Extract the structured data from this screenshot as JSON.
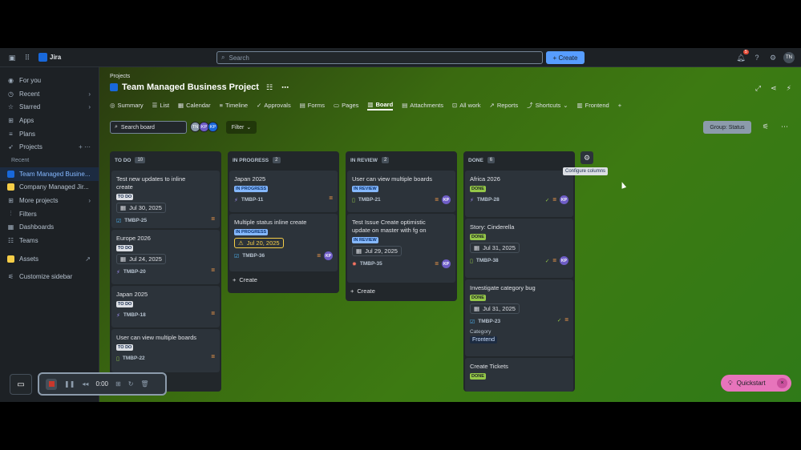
{
  "topnav": {
    "app_name": "Jira",
    "search_placeholder": "Search",
    "create_label": "+ Create",
    "notification_count": "5",
    "user_initials": "TN"
  },
  "sidebar": {
    "items": [
      {
        "label": "For you",
        "icon": "user-circle-icon"
      },
      {
        "label": "Recent",
        "icon": "clock-icon",
        "chevron": "›"
      },
      {
        "label": "Starred",
        "icon": "star-icon",
        "chevron": "›"
      },
      {
        "label": "Apps",
        "icon": "apps-icon"
      },
      {
        "label": "Plans",
        "icon": "plans-icon"
      },
      {
        "label": "Projects",
        "icon": "rocket-icon"
      }
    ],
    "recent_header": "Recent",
    "projects": [
      {
        "label": "Team Managed Busine...",
        "color": "#1868db"
      },
      {
        "label": "Company Managed Jir...",
        "color": "#f5cd47"
      }
    ],
    "more_projects": "More projects",
    "bottom_items": [
      {
        "label": "Filters",
        "icon": "filter-icon"
      },
      {
        "label": "Dashboards",
        "icon": "dashboard-icon"
      },
      {
        "label": "Teams",
        "icon": "people-icon"
      }
    ],
    "assets": "Assets",
    "customize": "Customize sidebar"
  },
  "main": {
    "breadcrumb": "Projects",
    "title": "Team Managed Business Project",
    "tabs": [
      "Summary",
      "List",
      "Calendar",
      "Timeline",
      "Approvals",
      "Forms",
      "Pages",
      "Board",
      "Attachments",
      "All work",
      "Reports",
      "Shortcuts",
      "Frontend"
    ],
    "tab_icons": [
      "◎",
      "☰",
      "▦",
      "≡",
      "✓",
      "▤",
      "▭",
      "▥",
      "▤",
      "⊡",
      "↗",
      "⤴",
      "▥"
    ],
    "active_tab": "Board",
    "add_tab": "+",
    "search_board": "Search board",
    "avatars": [
      {
        "initials": "TN",
        "color": "#8c9bab"
      },
      {
        "initials": "KP",
        "color": "#6e5dc6"
      },
      {
        "initials": "KP",
        "color": "#1868db"
      }
    ],
    "filter_label": "Filter",
    "group_label": "Group: Status"
  },
  "columns": [
    {
      "name": "TO DO",
      "count": "10",
      "cards": [
        {
          "title_lines": [
            "Test new updates to inline",
            "create"
          ],
          "status": "TO DO",
          "date": "Jul 30, 2025",
          "key": "TMBP-25",
          "type": "task"
        },
        {
          "title_lines": [
            "Europe 2026"
          ],
          "status": "TO DO",
          "date": "Jul 24, 2025",
          "key": "TMBP-20",
          "type": "epic"
        },
        {
          "title_lines": [
            "Japan 2025"
          ],
          "status": "TO DO",
          "key": "TMBP-18",
          "type": "epic"
        },
        {
          "title_lines": [
            "User can view multiple boards"
          ],
          "status": "TO DO",
          "key": "TMBP-22",
          "type": "story"
        }
      ]
    },
    {
      "name": "IN PROGRESS",
      "count": "2",
      "cards": [
        {
          "title_lines": [
            "Japan 2025"
          ],
          "status": "IN PROGRESS",
          "key": "TMBP-11",
          "type": "epic"
        },
        {
          "title_lines": [
            "Multiple status inline create"
          ],
          "status": "IN PROGRESS",
          "date": "Jul 20, 2025",
          "key": "TMBP-36",
          "type": "task",
          "assignee": "KP"
        }
      ],
      "create": "Create"
    },
    {
      "name": "IN REVIEW",
      "count": "2",
      "cards": [
        {
          "title_lines": [
            "User can view multiple boards"
          ],
          "status": "IN REVIEW",
          "key": "TMBP-21",
          "type": "story",
          "assignee": "KP"
        },
        {
          "title_lines": [
            "Test Issue Create optimistic",
            "update on master with fg on"
          ],
          "status": "IN REVIEW",
          "date": "Jul 29, 2025",
          "key": "TMBP-35",
          "type": "bug",
          "assignee": "KP"
        }
      ],
      "create": "Create"
    },
    {
      "name": "DONE",
      "count": "6",
      "cards": [
        {
          "title_lines": [
            "Africa 2026"
          ],
          "status": "DONE",
          "key": "TMBP-28",
          "type": "epic",
          "assignee": "KP"
        },
        {
          "title_lines": [
            "Story: Cinderella"
          ],
          "status": "DONE",
          "date": "Jul 31, 2025",
          "key": "TMBP-38",
          "type": "story",
          "assignee": "KP"
        },
        {
          "title_lines": [
            "Investigate category bug"
          ],
          "status": "DONE",
          "date": "Jul 31, 2025",
          "key": "TMBP-23",
          "type": "task",
          "category_label": "Category",
          "category": "Frontend"
        },
        {
          "title_lines": [
            "Create Tickets"
          ],
          "status": "DONE"
        }
      ]
    }
  ],
  "tooltip": "Configure columns",
  "quickstart": "Quickstart",
  "recorder": {
    "time": "0:00"
  },
  "colors": {
    "accent": "#579dff",
    "done": "#94c748",
    "inprogress": "#85b8ff",
    "priority": "#f99c4a"
  }
}
